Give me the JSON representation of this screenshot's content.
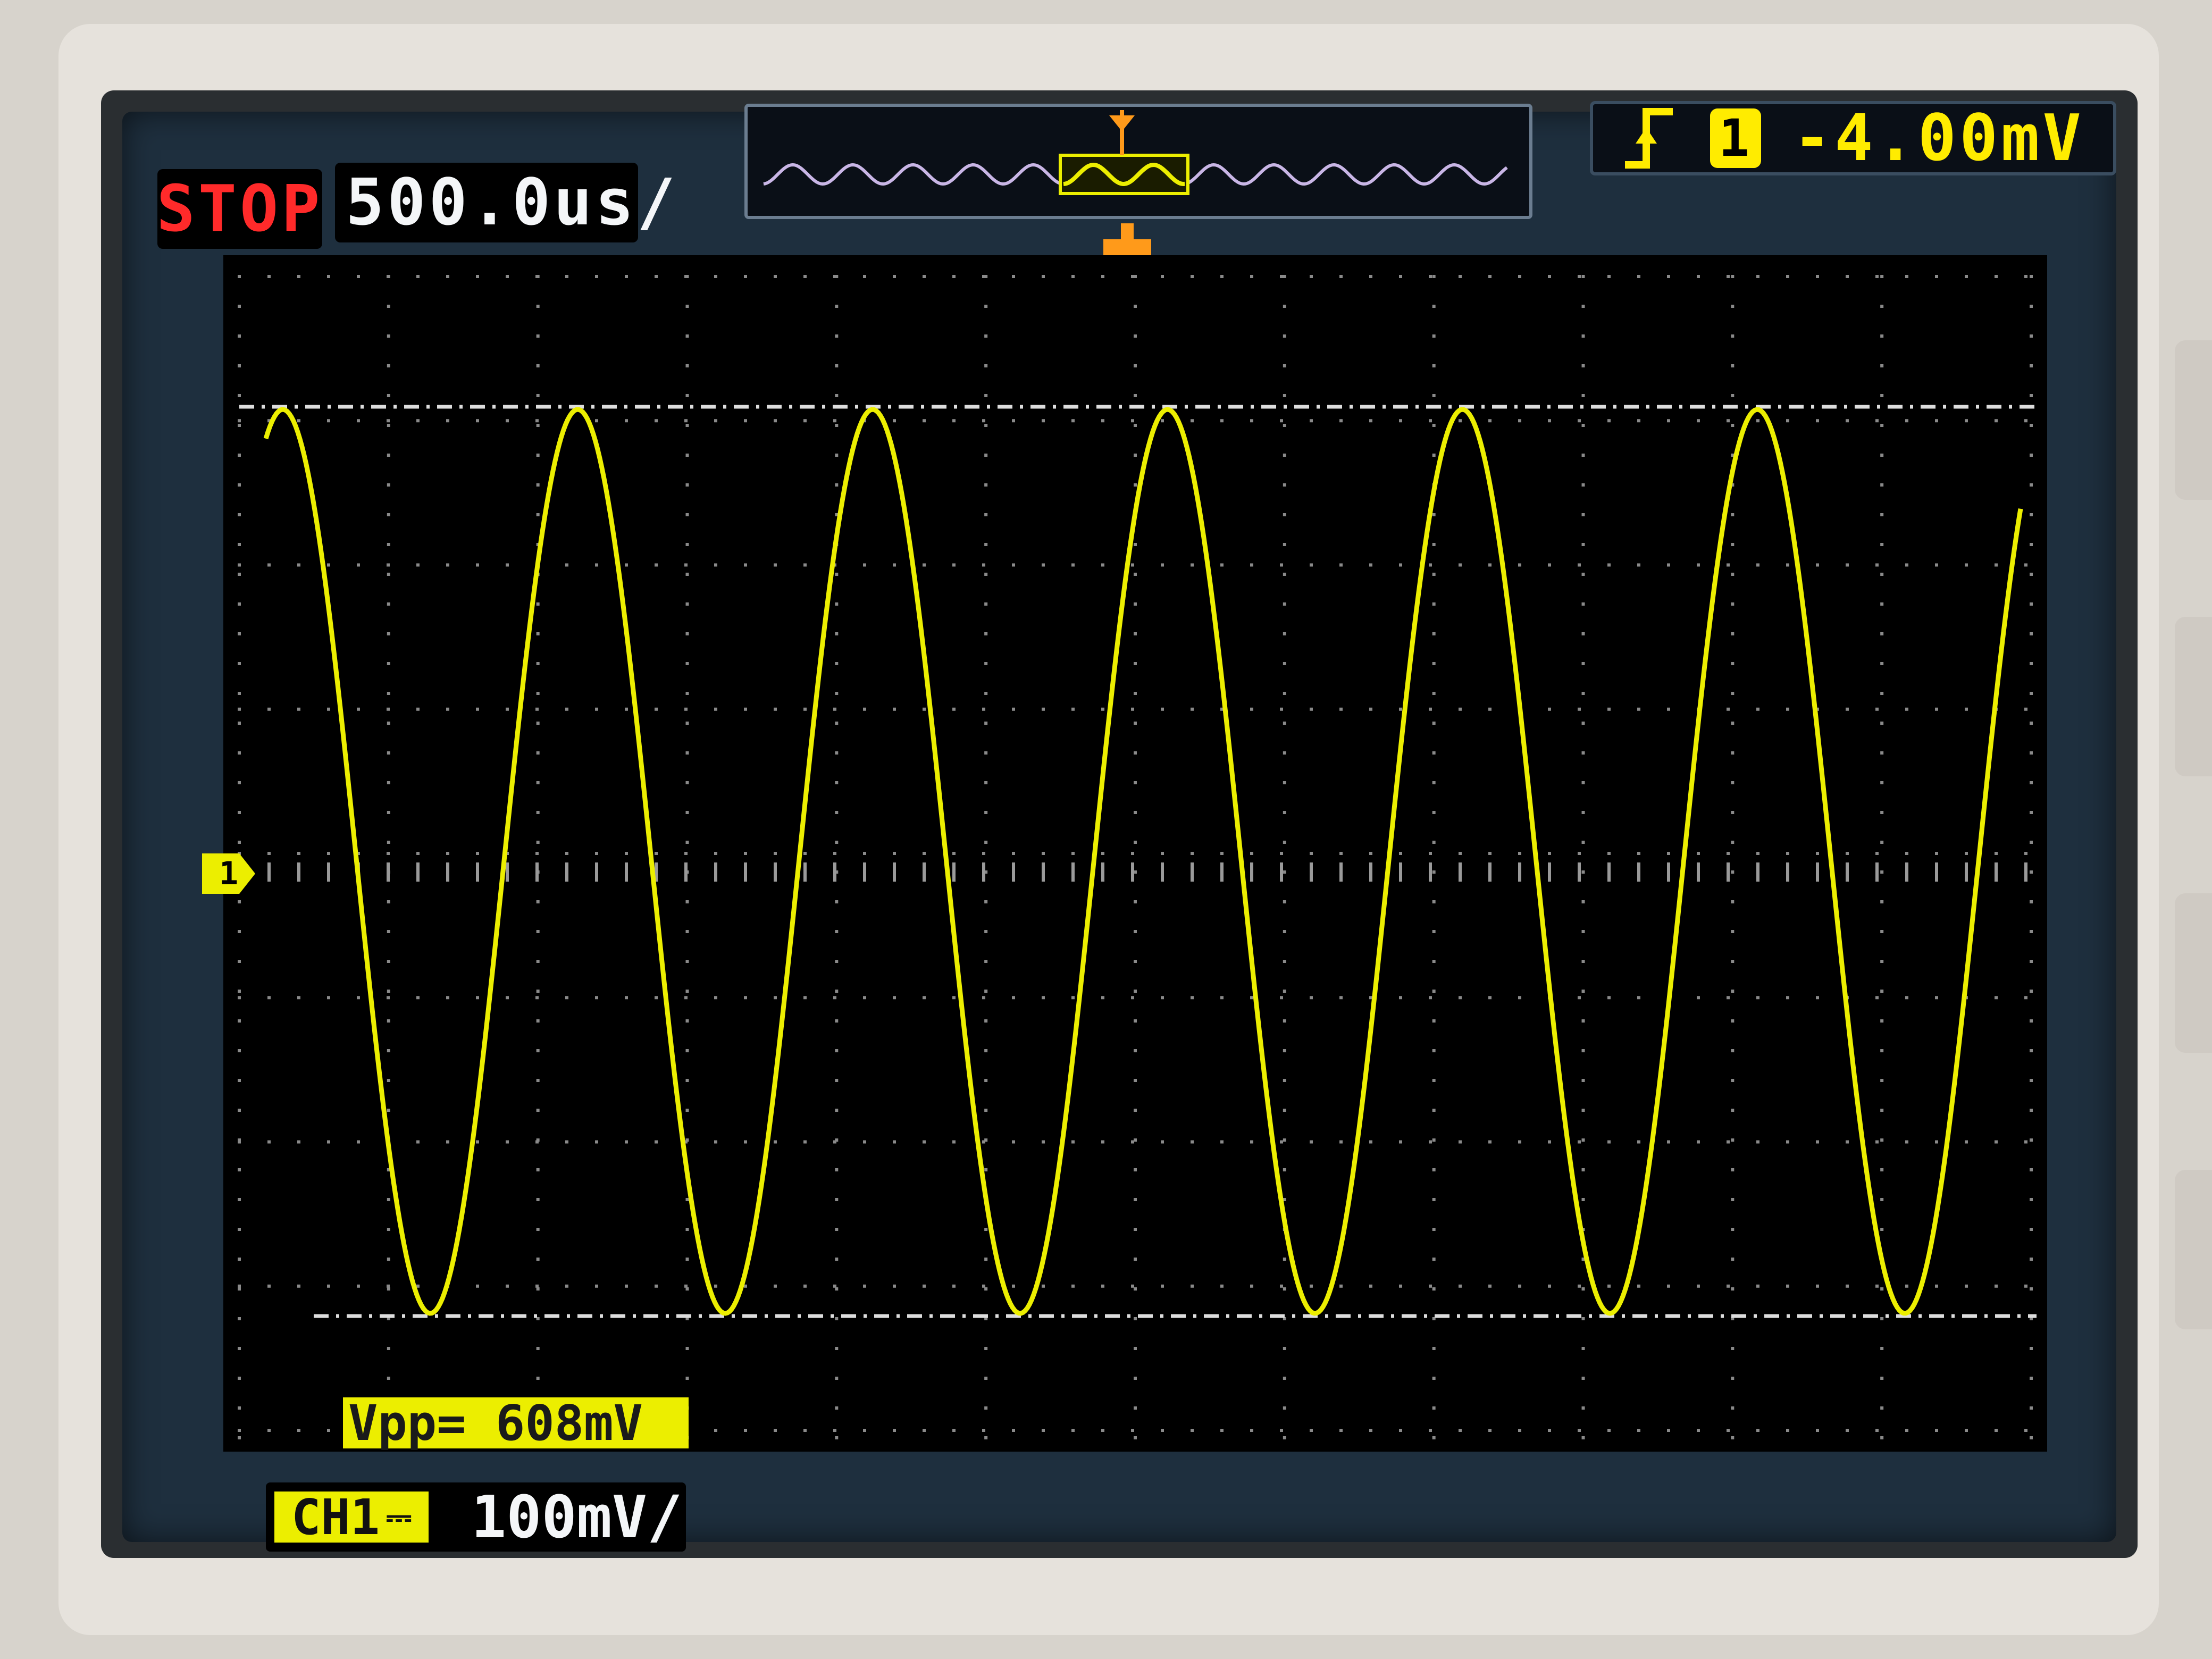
{
  "header": {
    "run_status": "STOP",
    "timebase": "500.0us/",
    "trigger": {
      "slope_icon": "rising-edge-icon",
      "source": "1",
      "level": "-4.00mV"
    }
  },
  "measurement": {
    "vpp": "Vpp= 608mV"
  },
  "channel_bar": {
    "channel": "CH1",
    "scale": "100mV/"
  },
  "ground_marker": "1",
  "trigger_marker": "T",
  "colors": {
    "trace": "#ecee00",
    "stop": "#ff2a2a",
    "trigger_marker": "#ff9a1a",
    "grid_dots": "#8a8a8a",
    "screen_bg": "#000000"
  },
  "waveform": {
    "type": "sine",
    "cycles_visible": 6,
    "peak_to_peak_mV": 608
  }
}
